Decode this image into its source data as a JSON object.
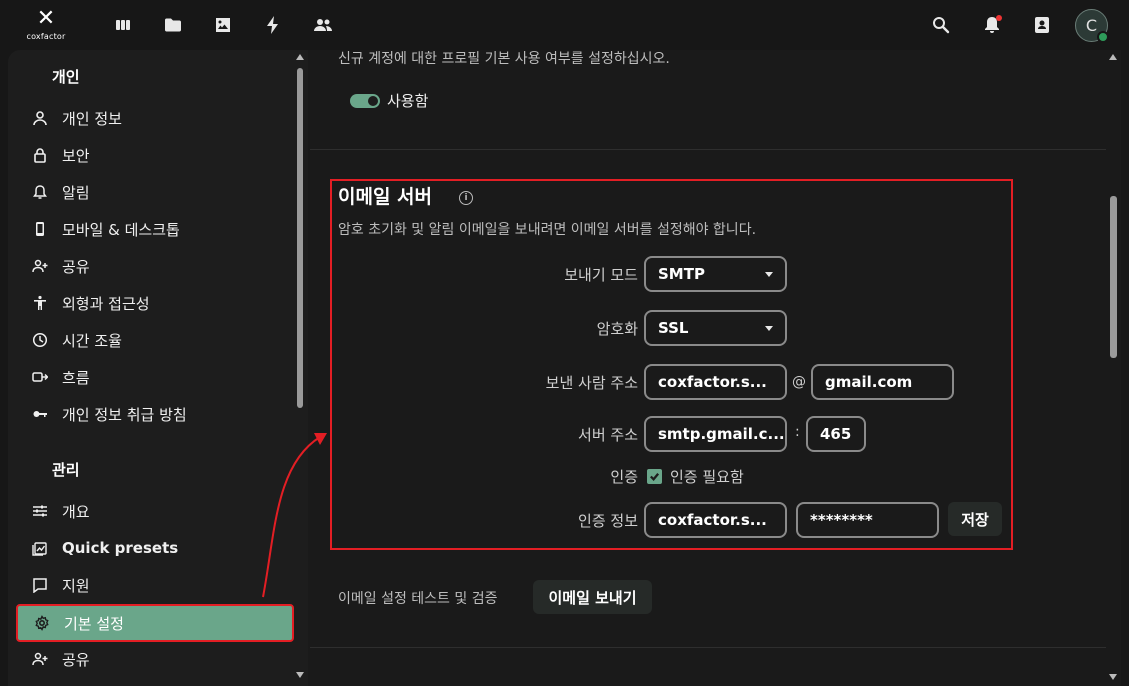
{
  "app": {
    "logo_text": "coxfactor"
  },
  "topbar": {
    "nav_icons": [
      "dashboard-icon",
      "files-icon",
      "photos-icon",
      "activity-icon",
      "contacts-icon"
    ],
    "right_icons": [
      "search-icon",
      "notifications-icon",
      "user-list-icon"
    ],
    "avatar_letter": "C"
  },
  "sidebar": {
    "personal_title": "개인",
    "personal_items": [
      {
        "label": "개인 정보",
        "icon": "person-icon"
      },
      {
        "label": "보안",
        "icon": "lock-icon"
      },
      {
        "label": "알림",
        "icon": "bell-icon"
      },
      {
        "label": "모바일 & 데스크톱",
        "icon": "phone-icon"
      },
      {
        "label": "공유",
        "icon": "share-icon"
      },
      {
        "label": "외형과 접근성",
        "icon": "accessibility-icon"
      },
      {
        "label": "시간 조율",
        "icon": "clock-icon"
      },
      {
        "label": "흐름",
        "icon": "flow-icon"
      },
      {
        "label": "개인 정보 취급 방침",
        "icon": "key-icon"
      }
    ],
    "admin_title": "관리",
    "admin_items": [
      {
        "label": "개요",
        "icon": "sliders-icon"
      },
      {
        "label": "Quick presets",
        "icon": "presets-icon"
      },
      {
        "label": "지원",
        "icon": "chat-icon"
      },
      {
        "label": "기본 설정",
        "icon": "gear-icon",
        "active": true
      },
      {
        "label": "공유",
        "icon": "share-icon"
      }
    ]
  },
  "profile": {
    "description": "신규 계정에 대한 프로필 기본 사용 여부를 설정하십시오.",
    "toggle_label": "사용함"
  },
  "email": {
    "title": "이메일 서버",
    "description": "암호 초기화 및 알림 이메일을 보내려면 이메일 서버를 설정해야 합니다.",
    "send_mode_label": "보내기 모드",
    "send_mode_value": "SMTP",
    "encryption_label": "암호화",
    "encryption_value": "SSL",
    "from_label": "보낸 사람 주소",
    "from_user": "coxfactor.s...",
    "at_sign": "@",
    "from_domain": "gmail.com",
    "server_label": "서버 주소",
    "server_host": "smtp.gmail.c...",
    "colon": ":",
    "server_port": "465",
    "auth_label": "인증",
    "auth_required_label": "인증 필요함",
    "credentials_label": "인증 정보",
    "credentials_user": "coxfactor.s...",
    "credentials_password": "********",
    "save_button": "저장",
    "test_label": "이메일 설정 테스트 및 검증",
    "test_button": "이메일 보내기"
  },
  "colors": {
    "accent": "#6aa68a",
    "highlight": "#e31e24",
    "background": "#1a1a1a"
  }
}
